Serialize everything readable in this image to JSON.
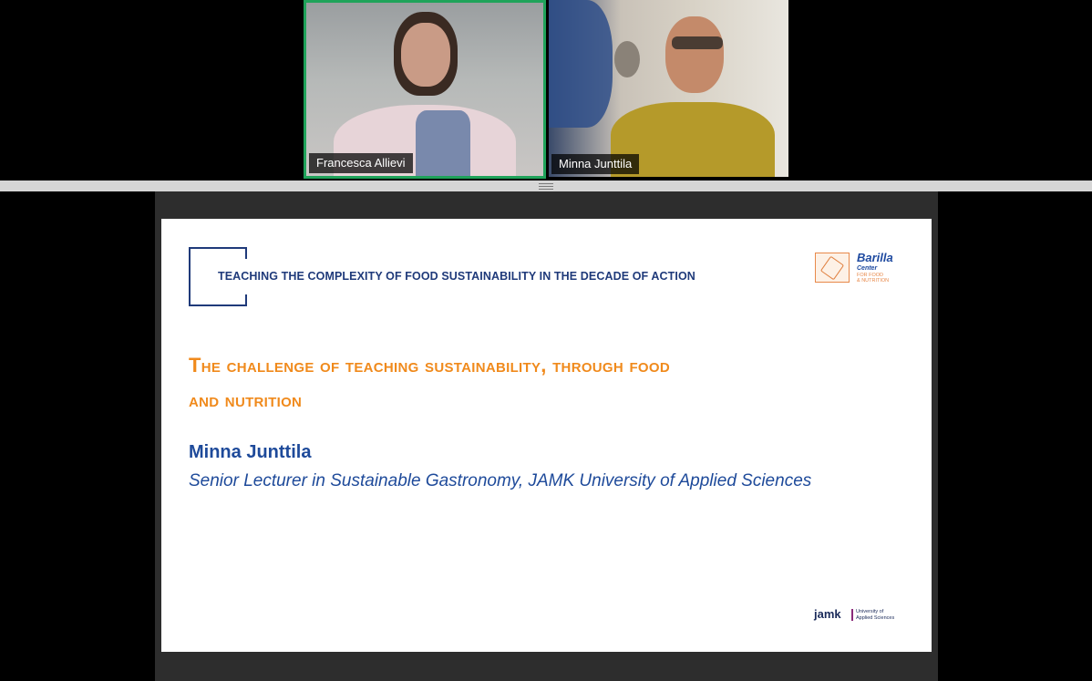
{
  "participants": [
    {
      "name": "Francesca Allievi",
      "active_speaker": true
    },
    {
      "name": "Minna Junttila",
      "active_speaker": false
    }
  ],
  "slide": {
    "header": "TEACHING THE COMPLEXITY OF FOOD SUSTAINABILITY IN THE DECADE OF ACTION",
    "title_line1": "The challenge of teaching sustainability, through food",
    "title_line2": "and nutrition",
    "presenter_name": "Minna Junttila",
    "presenter_role": "Senior Lecturer in Sustainable Gastronomy, JAMK University of Applied Sciences",
    "barilla_logo": {
      "name": "Barilla",
      "sub_line1": "Center",
      "sub_line2": "FOR FOOD",
      "sub_line3": "& NUTRITION"
    },
    "jamk_logo": {
      "word": "jamk",
      "sub_line1": "University of",
      "sub_line2": "Applied Sciences"
    }
  },
  "colors": {
    "active_speaker_border": "#1fa35a",
    "title_orange": "#f08a1c",
    "text_blue": "#1e4a9a",
    "header_navy": "#1f3a7a"
  }
}
